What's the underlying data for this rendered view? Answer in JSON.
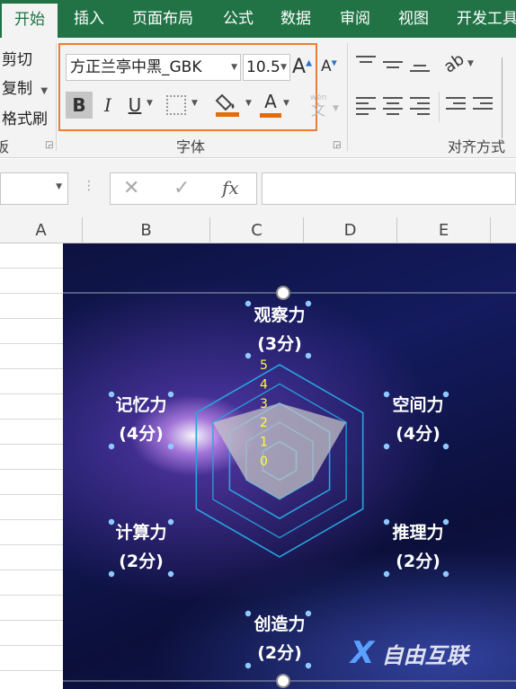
{
  "ribbon": {
    "tabs": [
      {
        "label": "开始",
        "active": true
      },
      {
        "label": "插入"
      },
      {
        "label": "页面布局"
      },
      {
        "label": "公式"
      },
      {
        "label": "数据"
      },
      {
        "label": "审阅"
      },
      {
        "label": "视图"
      },
      {
        "label": "开发工具"
      }
    ],
    "clipboard": {
      "cut": "剪切",
      "copy": "复制",
      "format_painter": "格式刷",
      "label_fragment": "板"
    },
    "font": {
      "name": "方正兰亭中黑_GBK",
      "size": "10.5",
      "group_label": "字体",
      "bold": "B",
      "italic": "I",
      "underline": "U",
      "font_color": "A",
      "grow": "A",
      "shrink": "A",
      "phonetic": "wén",
      "phonetic_char": "文"
    },
    "alignment": {
      "group_label": "对齐方式"
    },
    "accent_color": "#ed7d31"
  },
  "formula_bar": {
    "cancel": "✕",
    "enter": "✓",
    "fx": "fx",
    "formula": ""
  },
  "columns": [
    "A",
    "B",
    "C",
    "D",
    "E"
  ],
  "chart_data": {
    "type": "radar",
    "axes": [
      {
        "name": "观察力",
        "score_label": "(3分)",
        "value": 3
      },
      {
        "name": "空间力",
        "score_label": "(4分)",
        "value": 4
      },
      {
        "name": "推理力",
        "score_label": "(2分)",
        "value": 2
      },
      {
        "name": "创造力",
        "score_label": "(2分)",
        "value": 2
      },
      {
        "name": "计算力",
        "score_label": "(2分)",
        "value": 2
      },
      {
        "name": "记忆力",
        "score_label": "(4分)",
        "value": 4
      }
    ],
    "ticks": [
      "0",
      "1",
      "2",
      "3",
      "4",
      "5"
    ],
    "range": [
      0,
      5
    ],
    "grid_color": "#29a3e0",
    "fill_color": "#c8c8c8",
    "tick_color": "#ffff33"
  },
  "watermark": {
    "mark": "X",
    "text": "自由互联"
  }
}
